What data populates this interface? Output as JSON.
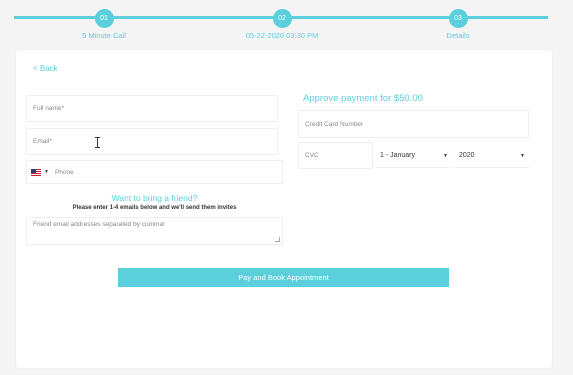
{
  "steps": [
    {
      "number": "01",
      "label": "5 Minute Call"
    },
    {
      "number": "02",
      "label": "05-22-2020 03:30 PM"
    },
    {
      "number": "03",
      "label": "Details"
    }
  ],
  "back_link": "< Back",
  "form": {
    "fullname_placeholder": "Full name*",
    "email_placeholder": "Email*",
    "phone_placeholder": "Phone",
    "friend_title": "Want to bring a friend?",
    "friend_instructions": "Please enter 1-4 emails below and we'll send them invites",
    "friend_placeholder": "Friend email addresses separated by comma!"
  },
  "payment": {
    "title": "Approve payment for $50.00",
    "card_number_placeholder": "Credit Card Number",
    "cvc_placeholder": "CVC",
    "month_value": "1 - January",
    "year_value": "2020"
  },
  "submit_label": "Pay and Book Appointment",
  "colors": {
    "accent": "#5ccfdc"
  },
  "icons": {
    "flag": "us-flag-icon",
    "caret": "caret-down-icon",
    "cursor": "text-cursor-icon"
  }
}
